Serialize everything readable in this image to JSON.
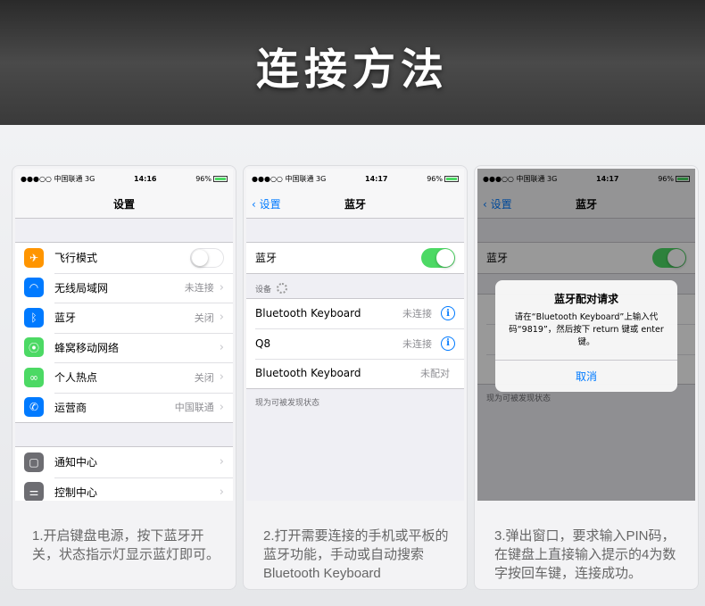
{
  "header": {
    "title": "连接方法"
  },
  "status": {
    "carrier": "●●●○○ 中国联通",
    "network": "3G",
    "battery": "96%",
    "time1": "14:16",
    "time2": "14:17",
    "time3": "14:17"
  },
  "screen1": {
    "nav_title": "设置",
    "rows": [
      {
        "label": "飞行模式",
        "value": "",
        "icon_color": "#ff9500",
        "icon": "airplane-icon"
      },
      {
        "label": "无线局域网",
        "value": "未连接",
        "icon_color": "#007aff",
        "icon": "wifi-icon"
      },
      {
        "label": "蓝牙",
        "value": "关闭",
        "icon_color": "#007aff",
        "icon": "bluetooth-icon"
      },
      {
        "label": "蜂窝移动网络",
        "value": "",
        "icon_color": "#4cd964",
        "icon": "cellular-icon"
      },
      {
        "label": "个人热点",
        "value": "关闭",
        "icon_color": "#4cd964",
        "icon": "hotspot-icon"
      },
      {
        "label": "运营商",
        "value": "中国联通",
        "icon_color": "#007aff",
        "icon": "phone-icon"
      }
    ],
    "rows2": [
      {
        "label": "通知中心",
        "icon_color": "#6d6d72",
        "icon": "notification-icon"
      },
      {
        "label": "控制中心",
        "icon_color": "#6d6d72",
        "icon": "control-center-icon"
      }
    ]
  },
  "screen2": {
    "back_label": "设置",
    "nav_title": "蓝牙",
    "bt_label": "蓝牙",
    "devices_label": "设备",
    "devices": [
      {
        "name": "Bluetooth Keyboard",
        "status": "未连接"
      },
      {
        "name": "Q8",
        "status": "未连接"
      },
      {
        "name": "Bluetooth Keyboard",
        "status": "未配对"
      }
    ],
    "footnote": "现为可被发现状态"
  },
  "screen3": {
    "back_label": "设置",
    "nav_title": "蓝牙",
    "bt_label": "蓝牙",
    "footnote": "现为可被发现状态",
    "alert": {
      "title": "蓝牙配对请求",
      "message": "请在“Bluetooth Keyboard”上输入代码“9819”，然后按下 return 键或 enter 键。",
      "button": "取消"
    }
  },
  "captions": {
    "step1": "1.开启键盘电源，按下蓝牙开关，状态指示灯显示蓝灯即可。",
    "step2": "2.打开需要连接的手机或平板的蓝牙功能，手动或自动搜索Bluetooth Keyboard",
    "step3": "3.弹出窗口，要求输入PIN码，在键盘上直接输入提示的4为数字按回车键，连接成功。"
  },
  "colors": {
    "accent": "#007aff",
    "toggle_on": "#4cd964"
  }
}
